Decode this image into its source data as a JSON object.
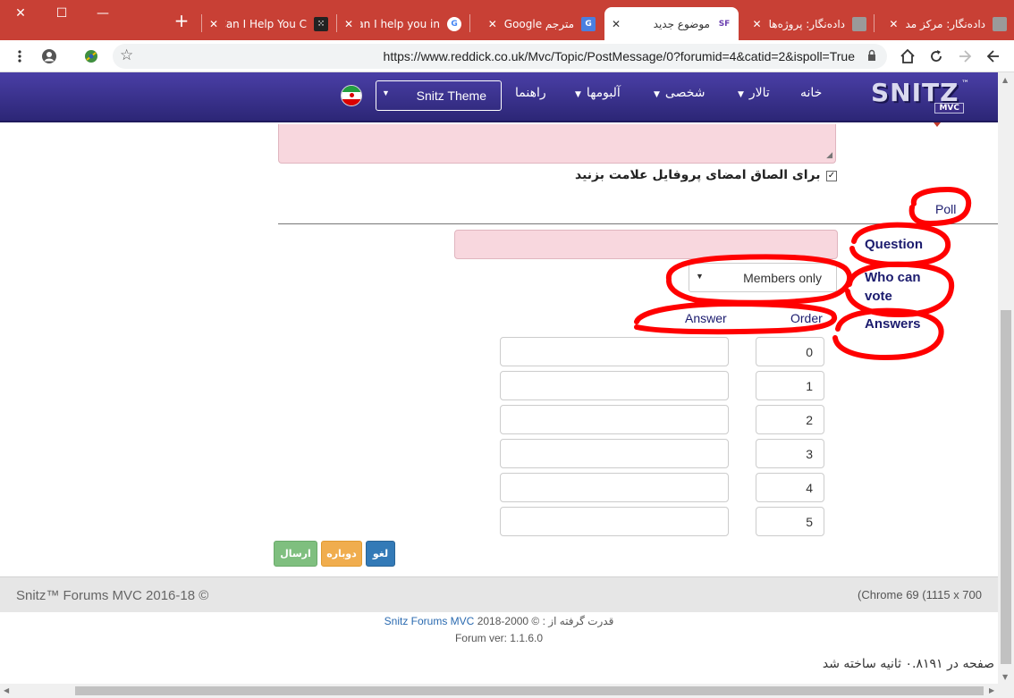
{
  "browser": {
    "tabs": [
      {
        "title": "دادەنگار: مرکز مد",
        "favicon": "site-favicon",
        "active": false
      },
      {
        "title": "دادەنگار: پروژه‌ها",
        "favicon": "site-favicon",
        "active": false
      },
      {
        "title": "موضوع جدید",
        "favicon": "SF",
        "active": true
      },
      {
        "title": "مترجم Google",
        "favicon": "google-translate-icon",
        "active": false
      },
      {
        "title": "Can I help you in",
        "favicon": "google-icon",
        "active": false
      },
      {
        "title": "Can I Help You C",
        "favicon": "dots-icon",
        "active": false
      }
    ],
    "url": "https://www.reddick.co.uk/Mvc/Topic/PostMessage/0?forumid=4&catid=2&ispoll=True"
  },
  "site_nav": {
    "logo_text": "SNITZ",
    "logo_sub": "MVC",
    "logo_tm": "™",
    "items": [
      {
        "label": "خانه",
        "has_caret": false
      },
      {
        "label": "تالار",
        "has_caret": true
      },
      {
        "label": "شخصی",
        "has_caret": true
      },
      {
        "label": "آلبومها",
        "has_caret": true
      },
      {
        "label": "راهنما",
        "has_caret": false
      }
    ],
    "theme_select": "Snitz Theme"
  },
  "form": {
    "signature_checkbox_label": "برای الصاق امضای پروفایل علامت بزنید",
    "signature_checked": true,
    "poll_title": "Poll",
    "question_label": "Question",
    "who_can_vote_label_line1": "Who can",
    "who_can_vote_label_line2": "vote",
    "who_can_vote_value": "Members only",
    "answers_label": "Answers",
    "col_answer": "Answer",
    "col_order": "Order",
    "answers": [
      {
        "order": "0",
        "answer": ""
      },
      {
        "order": "1",
        "answer": ""
      },
      {
        "order": "2",
        "answer": ""
      },
      {
        "order": "3",
        "answer": ""
      },
      {
        "order": "4",
        "answer": ""
      },
      {
        "order": "5",
        "answer": ""
      }
    ],
    "buttons": {
      "send": "ارسال",
      "reset": "دوباره",
      "cancel": "لغو"
    }
  },
  "footer": {
    "copyright": "Snitz™ Forums MVC 2016-18 ©",
    "browser_info": "(Chrome 69 (1115 x 700",
    "powered_prefix": "قدرت گرفته از :",
    "powered_link": "Snitz Forums MVC",
    "powered_years": "© 2000-2018",
    "version": "Forum ver: 1.1.6.0",
    "render_time": "صفحه در ۰.۸۱۹۱ ثانیه ساخته شد"
  },
  "colors": {
    "browser_frame": "#c84035",
    "nav_bg": "#3a3390",
    "field_pink": "#f8d7de",
    "label_navy": "#1b1b6e",
    "annotation_red": "#ff0000"
  }
}
